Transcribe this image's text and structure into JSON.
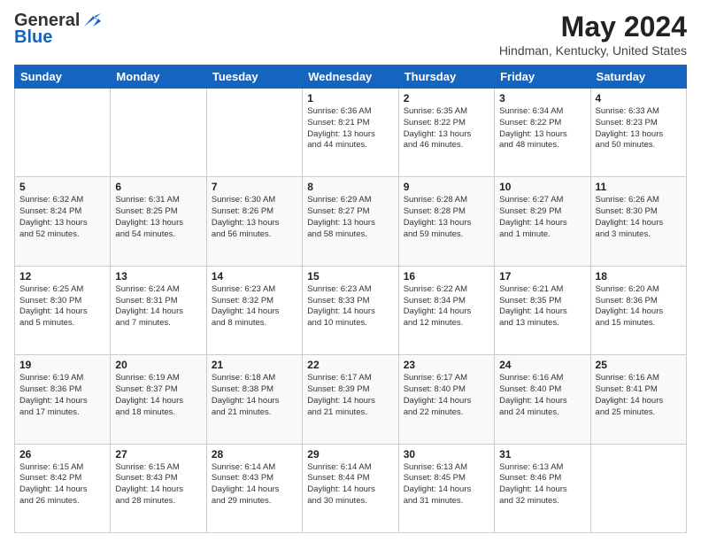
{
  "header": {
    "logo_line1": "General",
    "logo_line2": "Blue",
    "month_year": "May 2024",
    "location": "Hindman, Kentucky, United States"
  },
  "days_of_week": [
    "Sunday",
    "Monday",
    "Tuesday",
    "Wednesday",
    "Thursday",
    "Friday",
    "Saturday"
  ],
  "weeks": [
    [
      {
        "day": "",
        "info": ""
      },
      {
        "day": "",
        "info": ""
      },
      {
        "day": "",
        "info": ""
      },
      {
        "day": "1",
        "info": "Sunrise: 6:36 AM\nSunset: 8:21 PM\nDaylight: 13 hours\nand 44 minutes."
      },
      {
        "day": "2",
        "info": "Sunrise: 6:35 AM\nSunset: 8:22 PM\nDaylight: 13 hours\nand 46 minutes."
      },
      {
        "day": "3",
        "info": "Sunrise: 6:34 AM\nSunset: 8:22 PM\nDaylight: 13 hours\nand 48 minutes."
      },
      {
        "day": "4",
        "info": "Sunrise: 6:33 AM\nSunset: 8:23 PM\nDaylight: 13 hours\nand 50 minutes."
      }
    ],
    [
      {
        "day": "5",
        "info": "Sunrise: 6:32 AM\nSunset: 8:24 PM\nDaylight: 13 hours\nand 52 minutes."
      },
      {
        "day": "6",
        "info": "Sunrise: 6:31 AM\nSunset: 8:25 PM\nDaylight: 13 hours\nand 54 minutes."
      },
      {
        "day": "7",
        "info": "Sunrise: 6:30 AM\nSunset: 8:26 PM\nDaylight: 13 hours\nand 56 minutes."
      },
      {
        "day": "8",
        "info": "Sunrise: 6:29 AM\nSunset: 8:27 PM\nDaylight: 13 hours\nand 58 minutes."
      },
      {
        "day": "9",
        "info": "Sunrise: 6:28 AM\nSunset: 8:28 PM\nDaylight: 13 hours\nand 59 minutes."
      },
      {
        "day": "10",
        "info": "Sunrise: 6:27 AM\nSunset: 8:29 PM\nDaylight: 14 hours\nand 1 minute."
      },
      {
        "day": "11",
        "info": "Sunrise: 6:26 AM\nSunset: 8:30 PM\nDaylight: 14 hours\nand 3 minutes."
      }
    ],
    [
      {
        "day": "12",
        "info": "Sunrise: 6:25 AM\nSunset: 8:30 PM\nDaylight: 14 hours\nand 5 minutes."
      },
      {
        "day": "13",
        "info": "Sunrise: 6:24 AM\nSunset: 8:31 PM\nDaylight: 14 hours\nand 7 minutes."
      },
      {
        "day": "14",
        "info": "Sunrise: 6:23 AM\nSunset: 8:32 PM\nDaylight: 14 hours\nand 8 minutes."
      },
      {
        "day": "15",
        "info": "Sunrise: 6:23 AM\nSunset: 8:33 PM\nDaylight: 14 hours\nand 10 minutes."
      },
      {
        "day": "16",
        "info": "Sunrise: 6:22 AM\nSunset: 8:34 PM\nDaylight: 14 hours\nand 12 minutes."
      },
      {
        "day": "17",
        "info": "Sunrise: 6:21 AM\nSunset: 8:35 PM\nDaylight: 14 hours\nand 13 minutes."
      },
      {
        "day": "18",
        "info": "Sunrise: 6:20 AM\nSunset: 8:36 PM\nDaylight: 14 hours\nand 15 minutes."
      }
    ],
    [
      {
        "day": "19",
        "info": "Sunrise: 6:19 AM\nSunset: 8:36 PM\nDaylight: 14 hours\nand 17 minutes."
      },
      {
        "day": "20",
        "info": "Sunrise: 6:19 AM\nSunset: 8:37 PM\nDaylight: 14 hours\nand 18 minutes."
      },
      {
        "day": "21",
        "info": "Sunrise: 6:18 AM\nSunset: 8:38 PM\nDaylight: 14 hours\nand 21 minutes."
      },
      {
        "day": "22",
        "info": "Sunrise: 6:17 AM\nSunset: 8:39 PM\nDaylight: 14 hours\nand 21 minutes."
      },
      {
        "day": "23",
        "info": "Sunrise: 6:17 AM\nSunset: 8:40 PM\nDaylight: 14 hours\nand 22 minutes."
      },
      {
        "day": "24",
        "info": "Sunrise: 6:16 AM\nSunset: 8:40 PM\nDaylight: 14 hours\nand 24 minutes."
      },
      {
        "day": "25",
        "info": "Sunrise: 6:16 AM\nSunset: 8:41 PM\nDaylight: 14 hours\nand 25 minutes."
      }
    ],
    [
      {
        "day": "26",
        "info": "Sunrise: 6:15 AM\nSunset: 8:42 PM\nDaylight: 14 hours\nand 26 minutes."
      },
      {
        "day": "27",
        "info": "Sunrise: 6:15 AM\nSunset: 8:43 PM\nDaylight: 14 hours\nand 28 minutes."
      },
      {
        "day": "28",
        "info": "Sunrise: 6:14 AM\nSunset: 8:43 PM\nDaylight: 14 hours\nand 29 minutes."
      },
      {
        "day": "29",
        "info": "Sunrise: 6:14 AM\nSunset: 8:44 PM\nDaylight: 14 hours\nand 30 minutes."
      },
      {
        "day": "30",
        "info": "Sunrise: 6:13 AM\nSunset: 8:45 PM\nDaylight: 14 hours\nand 31 minutes."
      },
      {
        "day": "31",
        "info": "Sunrise: 6:13 AM\nSunset: 8:46 PM\nDaylight: 14 hours\nand 32 minutes."
      },
      {
        "day": "",
        "info": ""
      }
    ]
  ]
}
